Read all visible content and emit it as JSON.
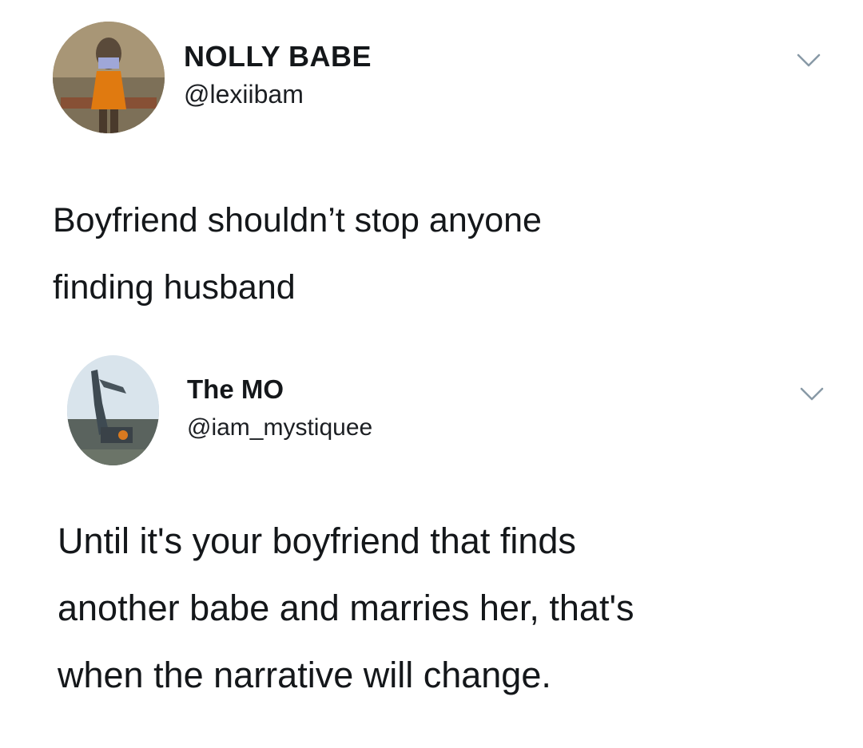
{
  "tweets": [
    {
      "author_name": "NOLLY BABE",
      "author_handle": "@lexiibam",
      "text": "Boyfriend shouldn’t stop anyone\nfinding husband",
      "menu_icon": "chevron-down-icon",
      "avatar_icon": "avatar"
    },
    {
      "author_name": "The MO",
      "author_handle": "@iam_mystiquee",
      "text": "Until it's your boyfriend that finds\nanother babe and marries her, that's\nwhen the narrative will change.",
      "menu_icon": "chevron-down-icon",
      "avatar_icon": "avatar"
    }
  ],
  "colors": {
    "text": "#14171a",
    "chevron": "#8899a6",
    "background": "#ffffff"
  }
}
